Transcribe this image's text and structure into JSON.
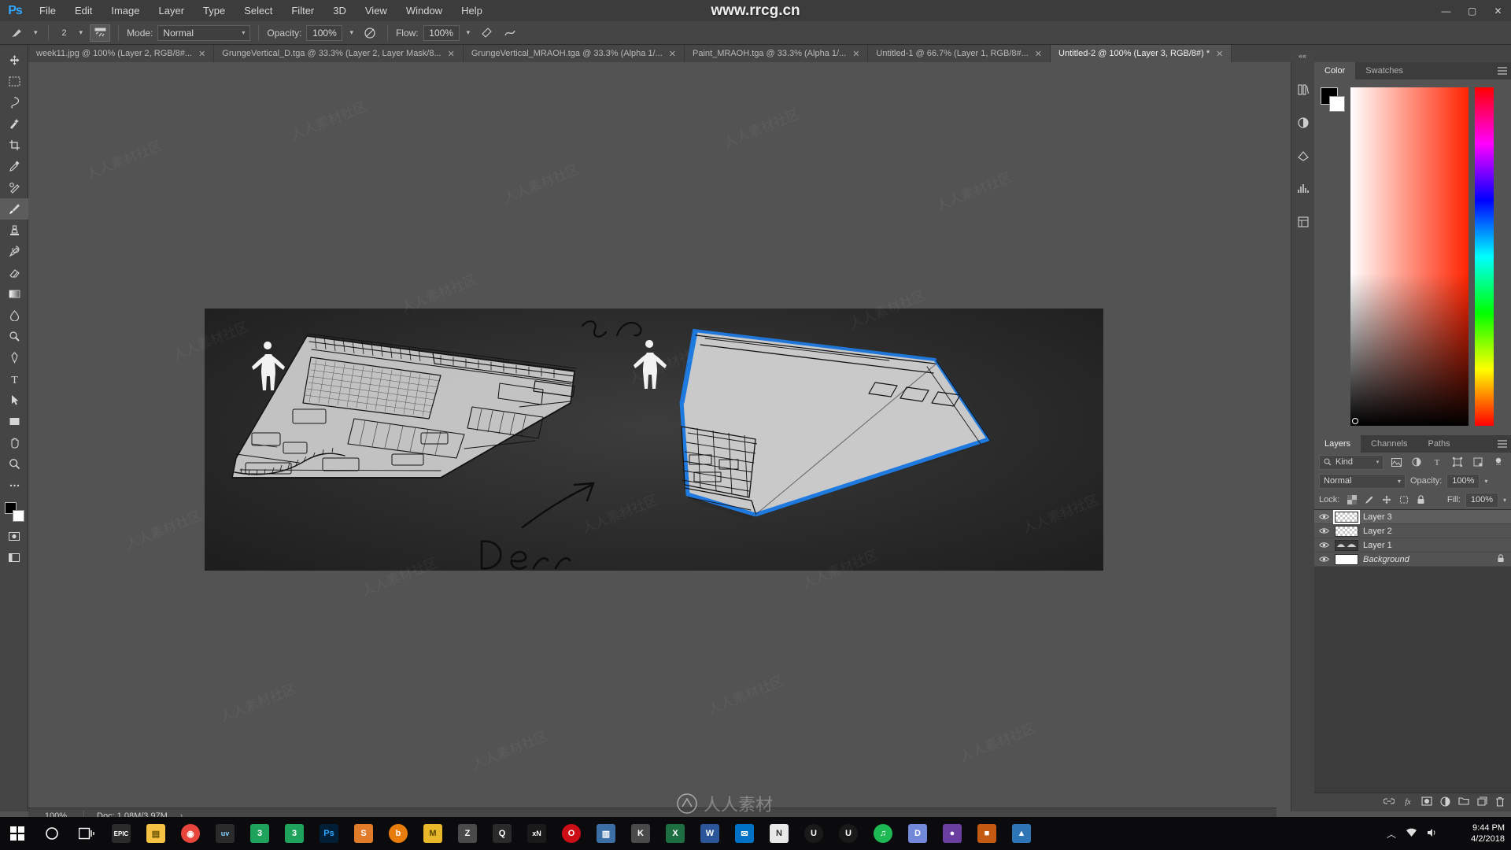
{
  "window": {
    "watermark_top": "www.rrcg.cn",
    "watermark_bottom": "人人素材",
    "minimize": "—",
    "maximize": "▢",
    "close": "✕"
  },
  "menubar": {
    "logo": "Ps",
    "items": [
      "File",
      "Edit",
      "Image",
      "Layer",
      "Type",
      "Select",
      "Filter",
      "3D",
      "View",
      "Window",
      "Help"
    ]
  },
  "options_bar": {
    "brush_icon": "brush-icon",
    "brush_size": "2",
    "airbrush_icon": "airbrush-icon",
    "mode_label": "Mode:",
    "mode_value": "Normal",
    "opacity_label": "Opacity:",
    "opacity_value": "100%",
    "pressure_opacity_icon": "pressure-opacity-icon",
    "flow_label": "Flow:",
    "flow_value": "100%",
    "airbrush_toggle_icon": "airbrush-toggle-icon",
    "smoothing_icon": "smoothing-icon",
    "angle_icon": "angle-icon",
    "symmetry_icon": "symmetry-icon",
    "search_icon": "search-icon",
    "workspace_icon": "workspace-icon"
  },
  "tabs": [
    {
      "label": "week11.jpg @ 100% (Layer 2, RGB/8#...",
      "close": "✕",
      "active": false
    },
    {
      "label": "GrungeVertical_D.tga @ 33.3% (Layer 2, Layer Mask/8...",
      "close": "✕",
      "active": false
    },
    {
      "label": "GrungeVertical_MRAOH.tga @ 33.3% (Alpha 1/...",
      "close": "✕",
      "active": false
    },
    {
      "label": "Paint_MRAOH.tga @ 33.3% (Alpha 1/...",
      "close": "✕",
      "active": false
    },
    {
      "label": "Untitled-1 @ 66.7% (Layer 1, RGB/8#...",
      "close": "✕",
      "active": false
    },
    {
      "label": "Untitled-2 @ 100% (Layer 3, RGB/8#) *",
      "close": "✕",
      "active": true
    }
  ],
  "toolbar": {
    "tools": [
      {
        "name": "move-tool",
        "glyph": "move",
        "selected": false
      },
      {
        "name": "marquee-tool",
        "glyph": "marquee",
        "selected": false
      },
      {
        "name": "lasso-tool",
        "glyph": "lasso",
        "selected": false
      },
      {
        "name": "quick-selection-tool",
        "glyph": "quickselect",
        "selected": false
      },
      {
        "name": "crop-tool",
        "glyph": "crop",
        "selected": false
      },
      {
        "name": "eyedropper-tool",
        "glyph": "eyedropper",
        "selected": false
      },
      {
        "name": "spot-healing-brush-tool",
        "glyph": "heal",
        "selected": false
      },
      {
        "name": "brush-tool",
        "glyph": "brush",
        "selected": true
      },
      {
        "name": "clone-stamp-tool",
        "glyph": "stamp",
        "selected": false
      },
      {
        "name": "history-brush-tool",
        "glyph": "historybrush",
        "selected": false
      },
      {
        "name": "eraser-tool",
        "glyph": "eraser",
        "selected": false
      },
      {
        "name": "gradient-tool",
        "glyph": "gradient",
        "selected": false
      },
      {
        "name": "blur-tool",
        "glyph": "blur",
        "selected": false
      },
      {
        "name": "dodge-tool",
        "glyph": "dodge",
        "selected": false
      },
      {
        "name": "pen-tool",
        "glyph": "pen",
        "selected": false
      },
      {
        "name": "type-tool",
        "glyph": "type",
        "selected": false
      },
      {
        "name": "path-selection-tool",
        "glyph": "pathselect",
        "selected": false
      },
      {
        "name": "rectangle-tool",
        "glyph": "rectangle",
        "selected": false
      },
      {
        "name": "hand-tool",
        "glyph": "hand",
        "selected": false
      },
      {
        "name": "zoom-tool",
        "glyph": "zoom",
        "selected": false
      },
      {
        "name": "edit-toolbar-button",
        "glyph": "ellipsis",
        "selected": false
      }
    ],
    "foreground_color": "#000000",
    "background_color": "#ffffff",
    "quickmask_icon": "quickmask-icon",
    "screenmode_icon": "screenmode-icon"
  },
  "status_bar": {
    "zoom": "100%",
    "doc": "Doc: 1.08M/3.97M",
    "arrow": "›"
  },
  "icon_rail": {
    "collapse": "««",
    "icons": [
      "libraries-icon",
      "adjustments-icon",
      "styles-icon",
      "histogram-icon",
      "properties-icon"
    ]
  },
  "color_panel": {
    "tabs": [
      {
        "label": "Color",
        "active": true
      },
      {
        "label": "Swatches",
        "active": false
      }
    ],
    "menu_icon": "panel-menu-icon",
    "foreground": "#000000",
    "background": "#ffffff",
    "ramp_hue": "#ff2400"
  },
  "layers_panel": {
    "tabs": [
      {
        "label": "Layers",
        "active": true
      },
      {
        "label": "Channels",
        "active": false
      },
      {
        "label": "Paths",
        "active": false
      }
    ],
    "menu_icon": "panel-menu-icon",
    "filter_label": "Kind",
    "filter_icon": "search-icon",
    "filter_type_icons": [
      "pixel-filter-icon",
      "adjustment-filter-icon",
      "type-filter-icon",
      "shape-filter-icon",
      "smartobject-filter-icon"
    ],
    "filter_toggle_icon": "filter-toggle-icon",
    "blend_mode": "Normal",
    "opacity_label": "Opacity:",
    "opacity_value": "100%",
    "lock_label": "Lock:",
    "lock_icons": [
      "lock-transparency-icon",
      "lock-image-icon",
      "lock-position-icon",
      "lock-artboard-icon",
      "lock-all-icon"
    ],
    "fill_label": "Fill:",
    "fill_value": "100%",
    "layers": [
      {
        "name": "Layer 3",
        "visible": true,
        "active": true,
        "thumb": "checker",
        "locked": false,
        "italic": false
      },
      {
        "name": "Layer 2",
        "visible": true,
        "active": false,
        "thumb": "checker",
        "locked": false,
        "italic": false
      },
      {
        "name": "Layer 1",
        "visible": true,
        "active": false,
        "thumb": "sketch",
        "locked": false,
        "italic": false
      },
      {
        "name": "Background",
        "visible": true,
        "active": false,
        "thumb": "white",
        "locked": true,
        "italic": true
      }
    ],
    "footer_icons": [
      "link-layers-icon",
      "layer-style-icon",
      "layer-mask-icon",
      "adjustment-layer-icon",
      "new-group-icon",
      "new-layer-icon",
      "delete-layer-icon"
    ]
  },
  "taskbar": {
    "items": [
      {
        "name": "start-button",
        "label": "⊞",
        "color": "#0b0b0d"
      },
      {
        "name": "cortana-search",
        "label": "○",
        "color": "#0b0b0d"
      },
      {
        "name": "task-view",
        "label": "❏",
        "color": "#0b0b0d"
      },
      {
        "name": "epic-games",
        "label": "EPIC",
        "color": "#2a2a2a"
      },
      {
        "name": "file-explorer",
        "label": "📁",
        "color": "#f5c243"
      },
      {
        "name": "google-chrome",
        "label": "C",
        "color": "#e8453c"
      },
      {
        "name": "substance-painter",
        "label": "uv",
        "color": "#2b2b2b"
      },
      {
        "name": "3ds-max-a",
        "label": "3",
        "color": "#1fa35c"
      },
      {
        "name": "3ds-max-b",
        "label": "3",
        "color": "#1fa35c"
      },
      {
        "name": "photoshop",
        "label": "Ps",
        "color": "#001e36"
      },
      {
        "name": "substance-designer",
        "label": "S",
        "color": "#e07b2a"
      },
      {
        "name": "blender",
        "label": "b",
        "color": "#e87d0d"
      },
      {
        "name": "marmoset-toolbag",
        "label": "M",
        "color": "#e8b82a"
      },
      {
        "name": "zbrush",
        "label": "Z",
        "color": "#4a4a4a"
      },
      {
        "name": "quixel-mixer",
        "label": "Q",
        "color": "#2a2a2a"
      },
      {
        "name": "xnormal",
        "label": "xN",
        "color": "#1a1a1a"
      },
      {
        "name": "opera-browser",
        "label": "O",
        "color": "#cc0f16"
      },
      {
        "name": "photos-app",
        "label": "🖼",
        "color": "#3a6ea5"
      },
      {
        "name": "knald",
        "label": "K",
        "color": "#4a4a4a"
      },
      {
        "name": "excel",
        "label": "X",
        "color": "#1d6f42"
      },
      {
        "name": "word",
        "label": "W",
        "color": "#2b579a"
      },
      {
        "name": "outlook",
        "label": "✉",
        "color": "#0072c6"
      },
      {
        "name": "notepad",
        "label": "N",
        "color": "#e8e8e8"
      },
      {
        "name": "unreal-engine-a",
        "label": "U",
        "color": "#1a1a1a"
      },
      {
        "name": "unreal-engine-b",
        "label": "U",
        "color": "#1a1a1a"
      },
      {
        "name": "spotify",
        "label": "♫",
        "color": "#1db954"
      },
      {
        "name": "discord",
        "label": "D",
        "color": "#7289da"
      },
      {
        "name": "app-28",
        "label": "●",
        "color": "#6a3fa0"
      },
      {
        "name": "app-29",
        "label": "■",
        "color": "#c45a11"
      },
      {
        "name": "app-30",
        "label": "▲",
        "color": "#2e75b6"
      }
    ],
    "tray_icons": [
      "show-hidden-icons",
      "network-icon",
      "volume-icon"
    ],
    "time": "9:44 PM",
    "date": "4/2/2018"
  }
}
